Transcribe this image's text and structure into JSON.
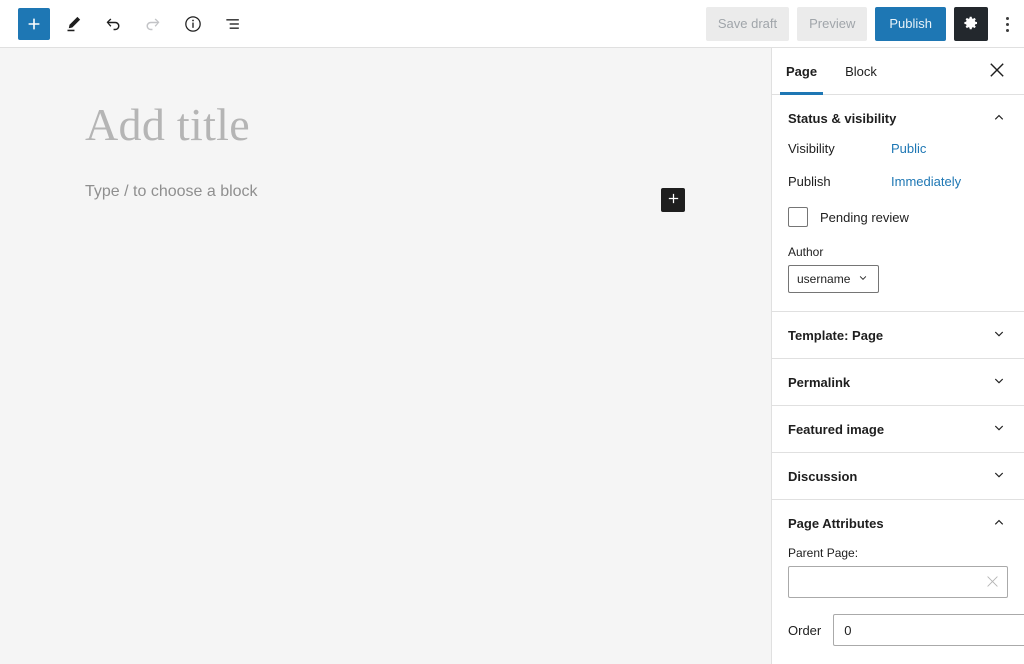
{
  "header": {
    "tools": [
      {
        "name": "add-block-button",
        "icon": "plus-icon",
        "label": "Add block",
        "state": "primary"
      },
      {
        "name": "tools-button",
        "icon": "pencil-icon",
        "label": "Tools",
        "state": "enabled"
      },
      {
        "name": "undo-button",
        "icon": "undo-icon",
        "label": "Undo",
        "state": "enabled"
      },
      {
        "name": "redo-button",
        "icon": "redo-icon",
        "label": "Redo",
        "state": "disabled"
      },
      {
        "name": "details-button",
        "icon": "info-icon",
        "label": "Details",
        "state": "enabled"
      },
      {
        "name": "list-view-button",
        "icon": "list-view-icon",
        "label": "List view",
        "state": "enabled"
      }
    ],
    "save_draft_label": "Save draft",
    "preview_label": "Preview",
    "publish_label": "Publish",
    "settings_icon": "gear-icon",
    "options_icon": "more-vertical-icon"
  },
  "canvas": {
    "title_placeholder": "Add title",
    "block_placeholder": "Type / to choose a block",
    "inserter_icon": "plus-icon"
  },
  "sidebar": {
    "tabs": [
      {
        "label": "Page",
        "active": true
      },
      {
        "label": "Block",
        "active": false
      }
    ],
    "close_icon": "close-icon",
    "panels": [
      {
        "title": "Status & visibility",
        "expanded": true,
        "chevron": "chevron-up-icon",
        "visibility_label": "Visibility",
        "visibility_value": "Public",
        "publish_label": "Publish",
        "publish_value": "Immediately",
        "pending_review_label": "Pending review",
        "pending_review_checked": false,
        "author_label": "Author",
        "author_value": "username",
        "author_chevron": "chevron-down-icon"
      },
      {
        "title": "Template: Page",
        "expanded": false,
        "chevron": "chevron-down-icon"
      },
      {
        "title": "Permalink",
        "expanded": false,
        "chevron": "chevron-down-icon"
      },
      {
        "title": "Featured image",
        "expanded": false,
        "chevron": "chevron-down-icon"
      },
      {
        "title": "Discussion",
        "expanded": false,
        "chevron": "chevron-down-icon"
      },
      {
        "title": "Page Attributes",
        "expanded": true,
        "chevron": "chevron-up-icon",
        "parent_page_label": "Parent Page:",
        "parent_page_value": "",
        "parent_page_placeholder": "",
        "clear_icon": "close-small-icon",
        "order_label": "Order",
        "order_value": "0"
      }
    ]
  },
  "colors": {
    "accent_blue": "#1e77b4",
    "dark": "#23282d",
    "canvas_bg": "#f5f5f5",
    "border": "#e0e0e0",
    "muted_text": "#a0a5aa"
  }
}
